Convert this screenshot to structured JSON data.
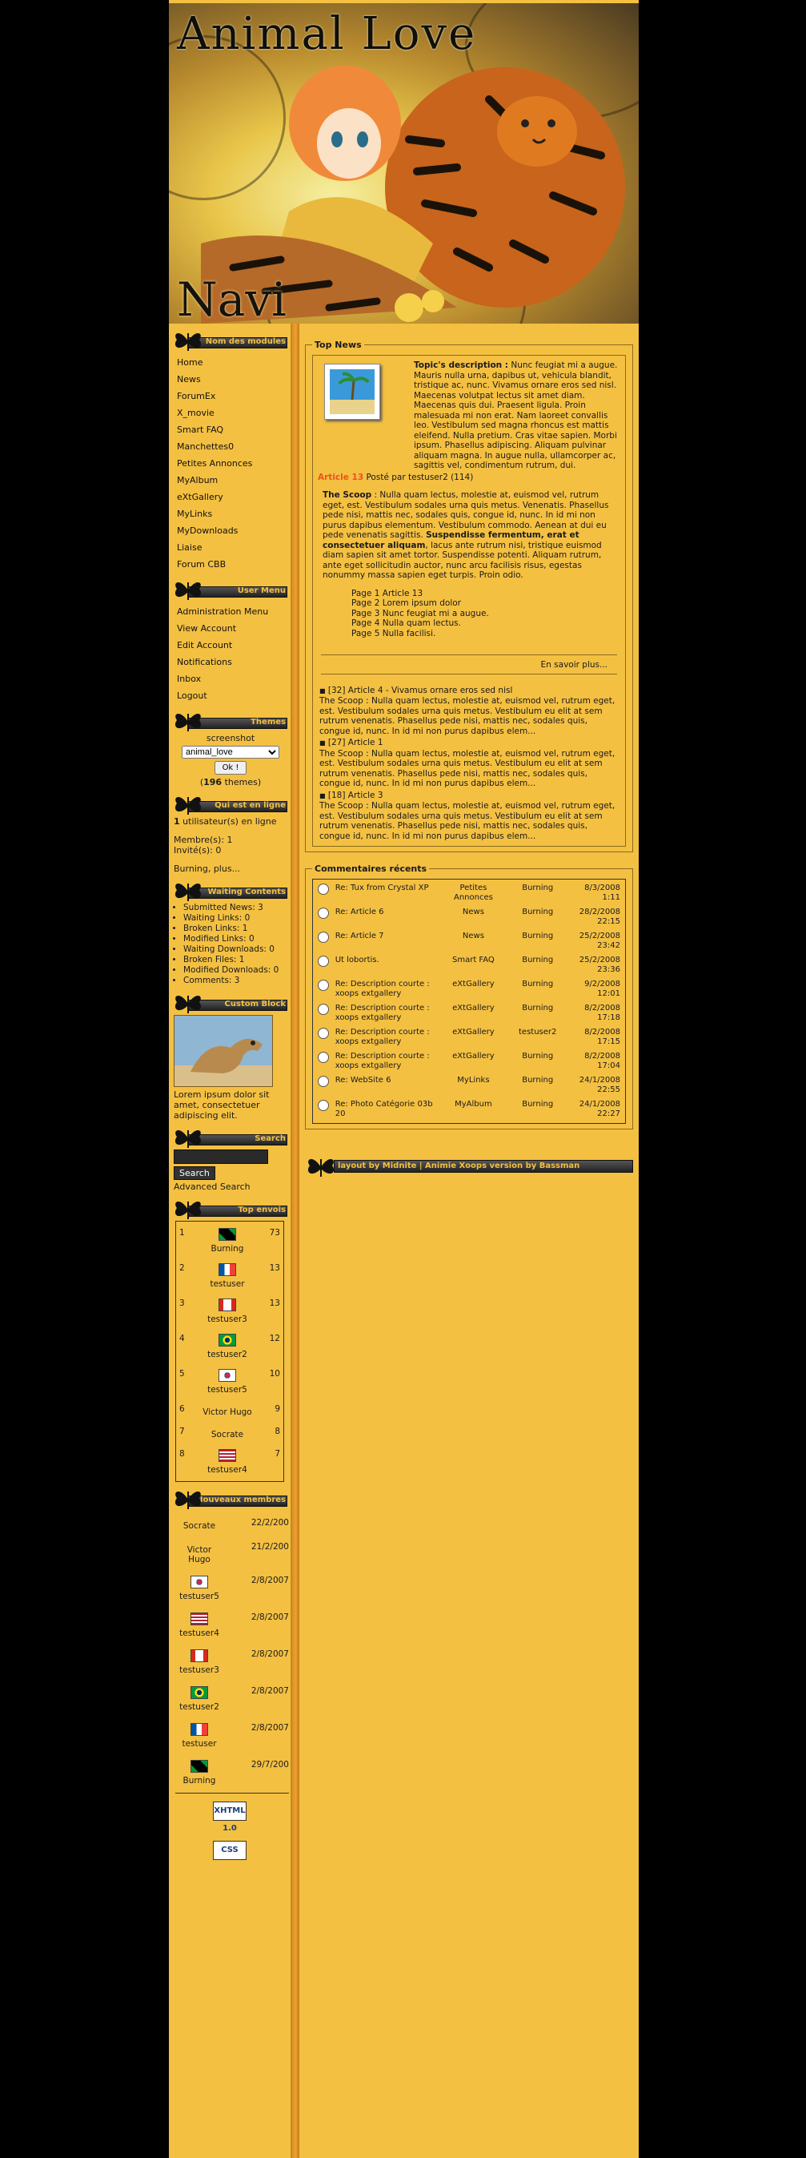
{
  "header": {
    "title": "Animal Love",
    "nav_caption": "Navi"
  },
  "left": {
    "modules": {
      "title": "Nom des modules",
      "items": [
        "Home",
        "News",
        "ForumEx",
        "X_movie",
        "Smart FAQ",
        "Manchettes0",
        "Petites Annonces",
        "MyAlbum",
        "eXtGallery",
        "MyLinks",
        "MyDownloads",
        "Liaise",
        "Forum CBB"
      ]
    },
    "user_menu": {
      "title": "User Menu",
      "items": [
        "Administration Menu",
        "View Account",
        "Edit Account",
        "Notifications",
        "Inbox",
        "Logout"
      ]
    },
    "themes": {
      "title": "Themes",
      "screenshot_label": "screenshot",
      "current": "animal_love",
      "ok": "Ok !",
      "count": "196",
      "count_label": " themes)"
    },
    "online": {
      "title": "Qui est en ligne",
      "users_count": "1",
      "users_label": " utilisateur(s) en ligne",
      "members": "Membre(s): 1",
      "guests": "Invité(s): 0",
      "who": "Burning, plus..."
    },
    "waiting": {
      "title": "Waiting Contents",
      "items": [
        "Submitted News: 3",
        "Waiting Links: 0",
        "Broken Links: 1",
        "Modified Links: 0",
        "Waiting Downloads: 0",
        "Broken Files: 1",
        "Modified Downloads: 0",
        "Comments: 3"
      ]
    },
    "custom": {
      "title": "Custom Block",
      "text": "Lorem ipsum dolor sit amet, consectetuer adipiscing elit."
    },
    "search": {
      "title": "Search",
      "button": "Search",
      "advanced": "Advanced Search"
    },
    "top": {
      "title": "Top envois",
      "rows": [
        {
          "rank": "1",
          "name": "Burning",
          "count": "73",
          "flag": "jm"
        },
        {
          "rank": "2",
          "name": "testuser",
          "count": "13",
          "flag": "fr"
        },
        {
          "rank": "3",
          "name": "testuser3",
          "count": "13",
          "flag": "ca"
        },
        {
          "rank": "4",
          "name": "testuser2",
          "count": "12",
          "flag": "br"
        },
        {
          "rank": "5",
          "name": "testuser5",
          "count": "10",
          "flag": "kr"
        },
        {
          "rank": "6",
          "name": "Victor Hugo",
          "count": "9",
          "flag": ""
        },
        {
          "rank": "7",
          "name": "Socrate",
          "count": "8",
          "flag": ""
        },
        {
          "rank": "8",
          "name": "testuser4",
          "count": "7",
          "flag": "us"
        }
      ]
    },
    "newmembers": {
      "title": "Nouveaux membres",
      "rows": [
        {
          "name": "Socrate",
          "date": "22/2/200",
          "flag": ""
        },
        {
          "name": "Victor Hugo",
          "date": "21/2/200",
          "flag": ""
        },
        {
          "name": "testuser5",
          "date": "2/8/2007",
          "flag": "kr"
        },
        {
          "name": "testuser4",
          "date": "2/8/2007",
          "flag": "us"
        },
        {
          "name": "testuser3",
          "date": "2/8/2007",
          "flag": "ca"
        },
        {
          "name": "testuser2",
          "date": "2/8/2007",
          "flag": "br"
        },
        {
          "name": "testuser",
          "date": "2/8/2007",
          "flag": "fr"
        },
        {
          "name": "Burning",
          "date": "29/7/200",
          "flag": "jm"
        }
      ]
    },
    "badges": {
      "xhtml": "XHTML 1.0",
      "css": "CSS"
    }
  },
  "news": {
    "legend": "Top News",
    "desc_label": "Topic's description :",
    "desc_text": " Nunc feugiat mi a augue. Mauris nulla urna, dapibus ut, vehicula blandit, tristique ac, nunc. Vivamus ornare eros sed nisl. Maecenas volutpat lectus sit amet diam. Maecenas quis dui. Praesent ligula. Proin malesuada mi non erat. Nam laoreet convallis leo. Vestibulum sed magna rhoncus est mattis eleifend. Nulla pretium. Cras vitae sapien. Morbi ipsum. Phasellus adipiscing. Aliquam pulvinar aliquam magna. In augue nulla, ullamcorper ac, sagittis vel, condimentum rutrum, dui.",
    "article_title": "Article 13",
    "posted": " Posté par testuser2 (114)",
    "scoop_label": "The Scoop",
    "scoop_text": " : Nulla quam lectus, molestie at, euismod vel, rutrum eget, est. Vestibulum sodales urna quis metus. Venenatis. Phasellus pede nisi, mattis nec, sodales quis, congue id, nunc. In id mi non purus dapibus elementum. Vestibulum commodo. Aenean at dui eu pede venenatis sagittis.",
    "bold_text": "Suspendisse fermentum, erat et consectetuer aliquam",
    "rest_text": ", lacus ante rutrum nisi, tristique euismod diam sapien sit amet tortor. Suspendisse potenti. Aliquam rutrum, ante eget sollicitudin auctor, nunc arcu facilisis risus, egestas nonummy massa sapien eget turpis. Proin odio.",
    "pages": [
      "Page 1 Article 13",
      "Page 2 Lorem ipsum dolor",
      "Page 3 Nunc feugiat mi a augue.",
      "Page 4 Nulla quam lectus.",
      "Page 5 Nulla facilisi."
    ],
    "more": "En savoir plus...",
    "others": [
      {
        "head": "[32] Article 4 - Vivamus ornare eros sed nisl",
        "body": "The Scoop : Nulla quam lectus, molestie at, euismod vel, rutrum eget, est. Vestibulum sodales urna quis metus. Vestibulum eu elit at sem rutrum venenatis. Phasellus pede nisi, mattis nec, sodales quis, congue id, nunc. In id mi non purus dapibus elem..."
      },
      {
        "head": "[27] Article 1",
        "body": "The Scoop : Nulla quam lectus, molestie at, euismod vel, rutrum eget, est. Vestibulum sodales urna quis metus. Vestibulum eu elit at sem rutrum venenatis. Phasellus pede nisi, mattis nec, sodales quis, congue id, nunc. In id mi non purus dapibus elem..."
      },
      {
        "head": "[18] Article 3",
        "body": "The Scoop : Nulla quam lectus, molestie at, euismod vel, rutrum eget, est. Vestibulum sodales urna quis metus. Vestibulum eu elit at sem rutrum venenatis. Phasellus pede nisi, mattis nec, sodales quis, congue id, nunc. In id mi non purus dapibus elem..."
      }
    ]
  },
  "comments": {
    "legend": "Commentaires récents",
    "rows": [
      {
        "title": "Re: Tux from Crystal XP",
        "module": "Petites Annonces",
        "user": "Burning",
        "date": "8/3/2008 1:11"
      },
      {
        "title": "Re: Article 6",
        "module": "News",
        "user": "Burning",
        "date": "28/2/2008 22:15"
      },
      {
        "title": "Re: Article 7",
        "module": "News",
        "user": "Burning",
        "date": "25/2/2008 23:42"
      },
      {
        "title": "Ut lobortis.",
        "module": "Smart FAQ",
        "user": "Burning",
        "date": "25/2/2008 23:36"
      },
      {
        "title": "Re: Description courte : xoops extgallery",
        "module": "eXtGallery",
        "user": "Burning",
        "date": "9/2/2008 12:01"
      },
      {
        "title": "Re: Description courte : xoops extgallery",
        "module": "eXtGallery",
        "user": "Burning",
        "date": "8/2/2008 17:18"
      },
      {
        "title": "Re: Description courte : xoops extgallery",
        "module": "eXtGallery",
        "user": "testuser2",
        "date": "8/2/2008 17:15"
      },
      {
        "title": "Re: Description courte : xoops extgallery",
        "module": "eXtGallery",
        "user": "Burning",
        "date": "8/2/2008 17:04"
      },
      {
        "title": "Re: WebSite 6",
        "module": "MyLinks",
        "user": "Burning",
        "date": "24/1/2008 22:55"
      },
      {
        "title": "Re: Photo Catégorie 03b 20",
        "module": "MyAlbum",
        "user": "Burning",
        "date": "24/1/2008 22:27"
      }
    ]
  },
  "footer": {
    "credit": "layout by Midnite | Animie Xoops version by Bassman"
  }
}
